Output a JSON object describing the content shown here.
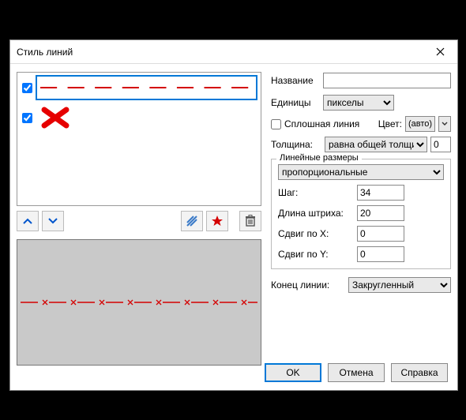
{
  "window": {
    "title": "Стиль линий",
    "close_icon": "✕"
  },
  "stylelist": {
    "items": [
      {
        "checked": true,
        "selected": true,
        "kind": "dashes"
      },
      {
        "checked": true,
        "selected": false,
        "kind": "cross"
      }
    ]
  },
  "toolbar": {
    "move_up_icon": "up",
    "move_down_icon": "down",
    "hatch_icon": "hatch",
    "star_icon": "star",
    "delete_icon": "trash"
  },
  "right": {
    "name_label": "Название",
    "name_value": "",
    "units_label": "Единицы",
    "units_value": "пикселы",
    "solid_label": "Сплошная линия",
    "solid_checked": false,
    "color_label": "Цвет:",
    "color_value": "(авто)",
    "thickness_label": "Толщина:",
    "thickness_mode": "равна общей толщине плюс",
    "thickness_value": "0",
    "fieldset_label": "Линейные размеры",
    "proportions": "пропорциональные",
    "step_label": "Шаг:",
    "step_value": "34",
    "dash_label": "Длина штриха:",
    "dash_value": "20",
    "shiftx_label": "Сдвиг по X:",
    "shiftx_value": "0",
    "shifty_label": "Сдвиг по Y:",
    "shifty_value": "0",
    "endline_label": "Конец линии:",
    "endline_value": "Закругленный"
  },
  "buttons": {
    "ok": "OK",
    "cancel": "Отмена",
    "help": "Справка"
  }
}
